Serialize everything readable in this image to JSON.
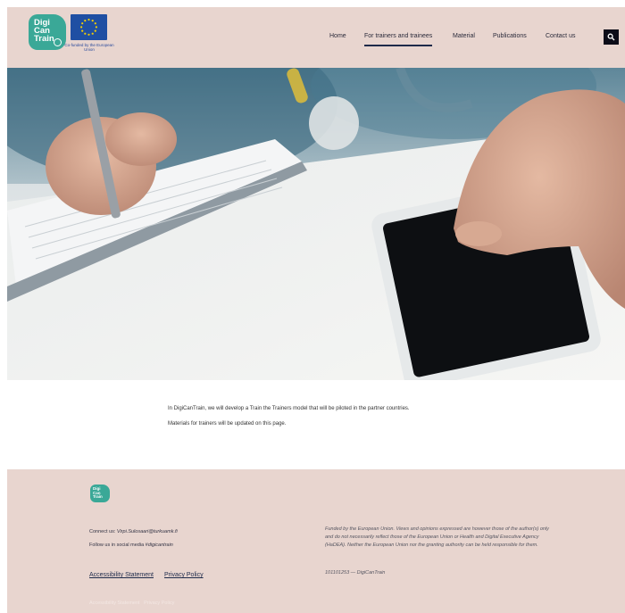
{
  "header": {
    "logo_text": "Digi Can Train",
    "eu_caption": "Co-funded by the European Union",
    "nav": [
      {
        "label": "Home",
        "active": false
      },
      {
        "label": "For trainers and trainees",
        "active": true
      },
      {
        "label": "Material",
        "active": false
      },
      {
        "label": "Publications",
        "active": false
      },
      {
        "label": "Contact us",
        "active": false
      }
    ],
    "search_icon": "search-icon"
  },
  "content": {
    "line1": "In DigiCanTrain, we will develop a Train the Trainers model that will be piloted in the partner countries.",
    "line2": "Materials for trainers will be updated on this page."
  },
  "footer": {
    "logo_text": "Digi Can Train",
    "contact_label": "Connect us: ",
    "contact_email": "Virpi.Sulosaari@turkuamk.fi",
    "social_label": "Follow us in social media ",
    "social_tag": "#digicantrain",
    "links": [
      "Accessibility Statement",
      "Privacy Policy"
    ],
    "disclaimer": "Funded by the European Union. Views and opinions expressed are however those of the author(s) only and do not necessarily reflect those of the European Union or Health and Digital Executive Agency (HaDEA). Neither the European Union nor the granting authority can be held responsible for them.",
    "grant": "101101253 — DigiCanTrain"
  },
  "colors": {
    "header_bg": "#e8d5cf",
    "brand_teal": "#3aa897",
    "eu_blue": "#1f4fa3",
    "nav_underline": "#1e2a4a"
  }
}
